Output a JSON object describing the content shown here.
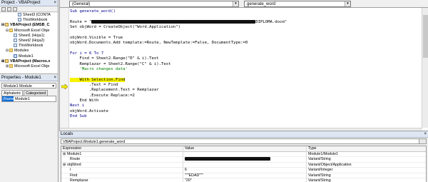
{
  "project_panel": {
    "title": "Project - VBAProject",
    "close": "×",
    "tree": [
      {
        "label": "Sheet3 (CONTA",
        "indent": 3,
        "icon": "sheet-icon"
      },
      {
        "label": "ThisWorkbook",
        "indent": 3,
        "icon": "workbook-icon"
      },
      {
        "label": "VBAProject (EMSB_C",
        "indent": 0,
        "icon": "project-icon",
        "expander": "⊟",
        "bold": true
      },
      {
        "label": "Microsoft Excel Obje",
        "indent": 1,
        "icon": "folder-icon",
        "expander": "⊟"
      },
      {
        "label": "Sheet1 (Hoja1)",
        "indent": 2,
        "icon": "sheet-icon"
      },
      {
        "label": "Sheet2 (Hoja2)",
        "indent": 2,
        "icon": "sheet-icon"
      },
      {
        "label": "ThisWorkbook",
        "indent": 2,
        "icon": "workbook-icon"
      },
      {
        "label": "Modules",
        "indent": 1,
        "icon": "folder-icon",
        "expander": "⊟"
      },
      {
        "label": "Module1",
        "indent": 2,
        "icon": "module-icon"
      },
      {
        "label": "VBAProject (Macros.x",
        "indent": 0,
        "icon": "project-icon",
        "expander": "⊞",
        "bold": true
      },
      {
        "label": "Microsoft Excel Obje",
        "indent": 1,
        "icon": "folder-icon",
        "expander": "⊞"
      }
    ]
  },
  "properties_panel": {
    "title": "Properties - Module1",
    "close": "×",
    "object": "Module1 Module",
    "tabs": [
      "Alphabetic",
      "Categorized"
    ],
    "row": {
      "name": "(Name)",
      "value": "Module1"
    }
  },
  "code_window": {
    "object_dropdown": "(General)",
    "proc_dropdown": "generate_word",
    "lines": [
      [
        {
          "t": "Sub generate_word()",
          "c": "kw"
        }
      ],
      [],
      [
        {
          "t": "Route = \""
        },
        {
          "redact": 230
        },
        {
          "t": "DIPLOMA.docm\""
        }
      ],
      [
        {
          "t": "Set objWord = CreateObject(\"Word.Application\")"
        }
      ],
      [],
      [
        {
          "t": "objWord.Visible = True"
        }
      ],
      [
        {
          "t": "objWord.Documents.Add template:=Route, NewTemplate:=False, DocumentType:=0"
        }
      ],
      [],
      [
        {
          "t": "For i = 6 To 7",
          "c": "kw"
        }
      ],
      [
        {
          "t": "    Find = Sheet2.Range(\"D\" & i).Text"
        }
      ],
      [
        {
          "t": "    Remplazar = Sheet2.Range(\"C\" & i).Text"
        }
      ],
      [
        {
          "t": "    'Macro changes data'",
          "c": "cm"
        }
      ],
      [],
      [
        {
          "t": "    With Selection.Find",
          "c": "hl"
        }
      ],
      [
        {
          "t": "        .Text = Find"
        }
      ],
      [
        {
          "t": "        .Replacement.Text = Remplazar"
        }
      ],
      [
        {
          "t": "        .Execute Replace:=2"
        }
      ],
      [
        {
          "t": "    End With"
        }
      ],
      [
        {
          "t": "Next i",
          "c": "kw"
        }
      ],
      [
        {
          "t": "objWord.Activate"
        }
      ],
      [
        {
          "t": "End Sub",
          "c": "kw"
        }
      ]
    ]
  },
  "locals": {
    "title": "Locals",
    "close": "×",
    "context": "VBAProject.Module1.generate_word",
    "headers": {
      "expression": "Expression",
      "value": "Value",
      "type": "Type"
    },
    "rows": [
      {
        "expr": "Module1",
        "value": "",
        "type": "Module1/Module1",
        "expander": "⊞",
        "level": 0
      },
      {
        "expr": "Route",
        "value_redacted": 120,
        "type": "Variant/String",
        "level": 1
      },
      {
        "expr": "objWord",
        "value": "",
        "type": "Variant/Object/Application",
        "expander": "⊞",
        "level": 0
      },
      {
        "expr": "i",
        "value": "6",
        "type": "Variant/Integer",
        "level": 1
      },
      {
        "expr": "Find",
        "value": "\"\"\"EDAD\"\"\"",
        "type": "Variant/String",
        "level": 1
      },
      {
        "expr": "Remplazar",
        "value": "\"20\"",
        "type": "Variant/String",
        "level": 1
      }
    ]
  },
  "colors": {
    "keyword": "#00008b",
    "comment": "#008000",
    "highlight": "#f7f200",
    "selection": "#0a6cd8"
  }
}
